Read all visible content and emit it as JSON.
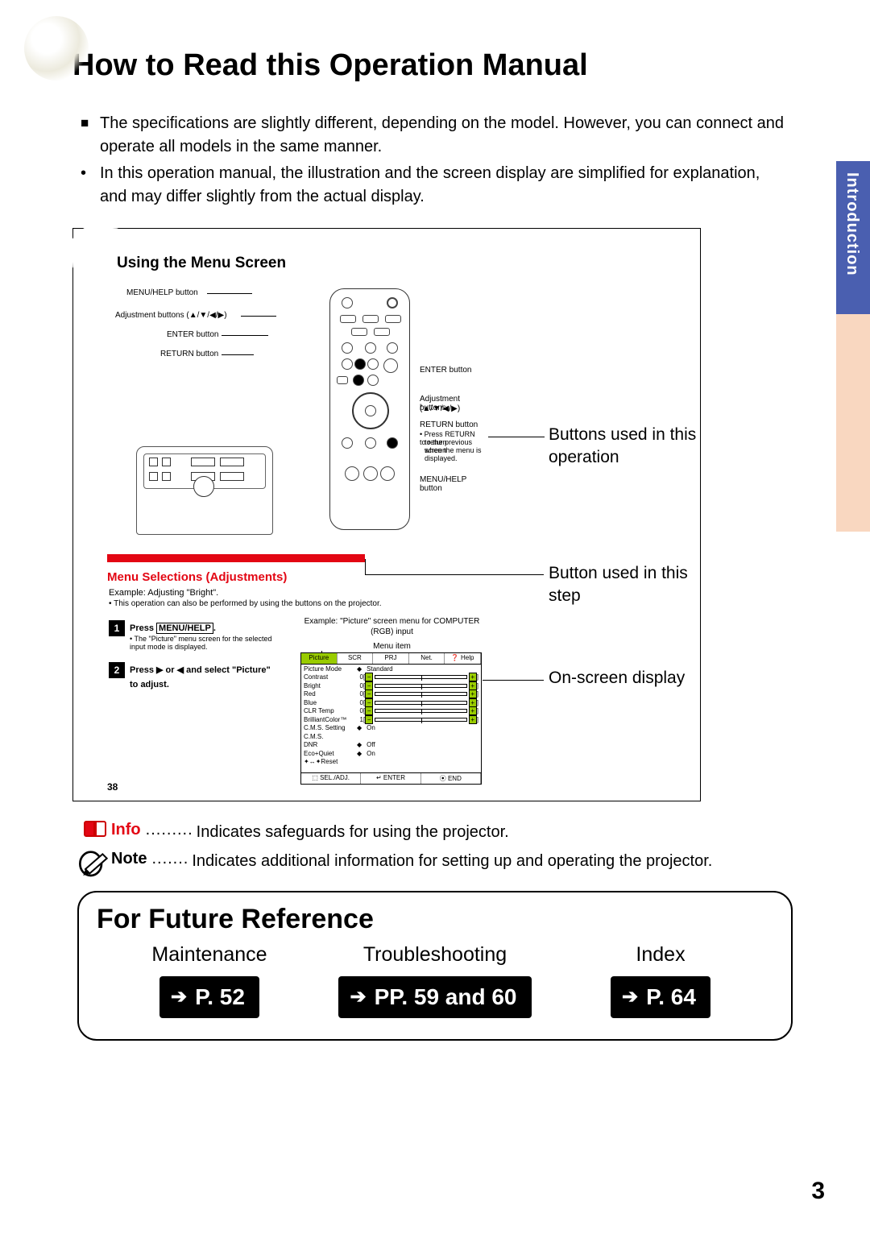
{
  "side_tab": "Introduction",
  "page_title": "How to Read this Operation Manual",
  "intro_bullets": {
    "b1": "The specifications are slightly different, depending on the model. However, you can connect and operate all models in the same manner.",
    "b2": "In this operation manual, the illustration and the screen display are simplified for explanation, and may differ slightly from the actual display."
  },
  "diagram": {
    "title": "Using the Menu Screen",
    "labels": {
      "menu_help": "MENU/HELP button",
      "adj_buttons_full": "Adjustment buttons (▲/▼/◀/▶)",
      "enter": "ENTER button",
      "return": "RETURN button",
      "adj_buttons": "Adjustment buttons",
      "adj_dir": "(▲/▼/◀/▶)",
      "return_hint1": "• Press RETURN to return",
      "return_hint2": "to the previous screen",
      "return_hint3": "when the menu is",
      "return_hint4": "displayed."
    },
    "annotations": {
      "a1": "Buttons used in this operation",
      "a2": "Button used in this step",
      "a3": "On-screen display"
    },
    "section_header": "Menu Selections (Adjustments)",
    "example_line": "Example: Adjusting \"Bright\".",
    "example_sub": "• This operation can also be performed by using the buttons on the projector.",
    "steps": [
      {
        "num": "1",
        "bold": "Press MENU/HELP.",
        "sub": "• The \"Picture\" menu screen for the selected input mode is displayed."
      },
      {
        "num": "2",
        "bold": "Press ▶ or ◀ and select \"Picture\" to adjust.",
        "sub": ""
      }
    ],
    "osd": {
      "caption": "Example: \"Picture\" screen menu for COMPUTER (RGB) input",
      "menu_item": "Menu item",
      "tabs": [
        "Picture",
        "SCR",
        "PRJ",
        "Net.",
        "❓ Help"
      ],
      "rows": [
        {
          "label": "Picture Mode",
          "type": "sel",
          "val": "Standard"
        },
        {
          "label": "Contrast",
          "type": "bar",
          "val": "0"
        },
        {
          "label": "Bright",
          "type": "bar",
          "val": "0"
        },
        {
          "label": "Red",
          "type": "bar",
          "val": "0"
        },
        {
          "label": "Blue",
          "type": "bar",
          "val": "0"
        },
        {
          "label": "CLR Temp",
          "type": "bar",
          "val": "0"
        },
        {
          "label": "BrilliantColor™",
          "type": "bar",
          "val": "1"
        },
        {
          "label": "C.M.S. Setting",
          "type": "sel",
          "val": "On"
        },
        {
          "label": "C.M.S.",
          "type": "plain",
          "val": ""
        },
        {
          "label": "DNR",
          "type": "sel",
          "val": "Off"
        },
        {
          "label": "Eco+Quiet",
          "type": "sel",
          "val": "On"
        },
        {
          "label": "✦↔✦Reset",
          "type": "plain",
          "val": ""
        }
      ],
      "footer": [
        "⬚ SEL./ADJ.",
        "↵ ENTER",
        "⦿ END"
      ]
    },
    "inset_page": "38"
  },
  "legend": {
    "info_label": "Info",
    "info_dots": ".........",
    "info_text": "Indicates safeguards for using the projector.",
    "note_label": "Note",
    "note_dots": ".......",
    "note_text": "Indicates additional information for setting up and operating the projector."
  },
  "future": {
    "title": "For Future Reference",
    "cols": [
      {
        "label": "Maintenance",
        "ref": "P. 52"
      },
      {
        "label": "Troubleshooting",
        "ref": "PP. 59 and 60"
      },
      {
        "label": "Index",
        "ref": "P. 64"
      }
    ]
  },
  "page_number": "3"
}
